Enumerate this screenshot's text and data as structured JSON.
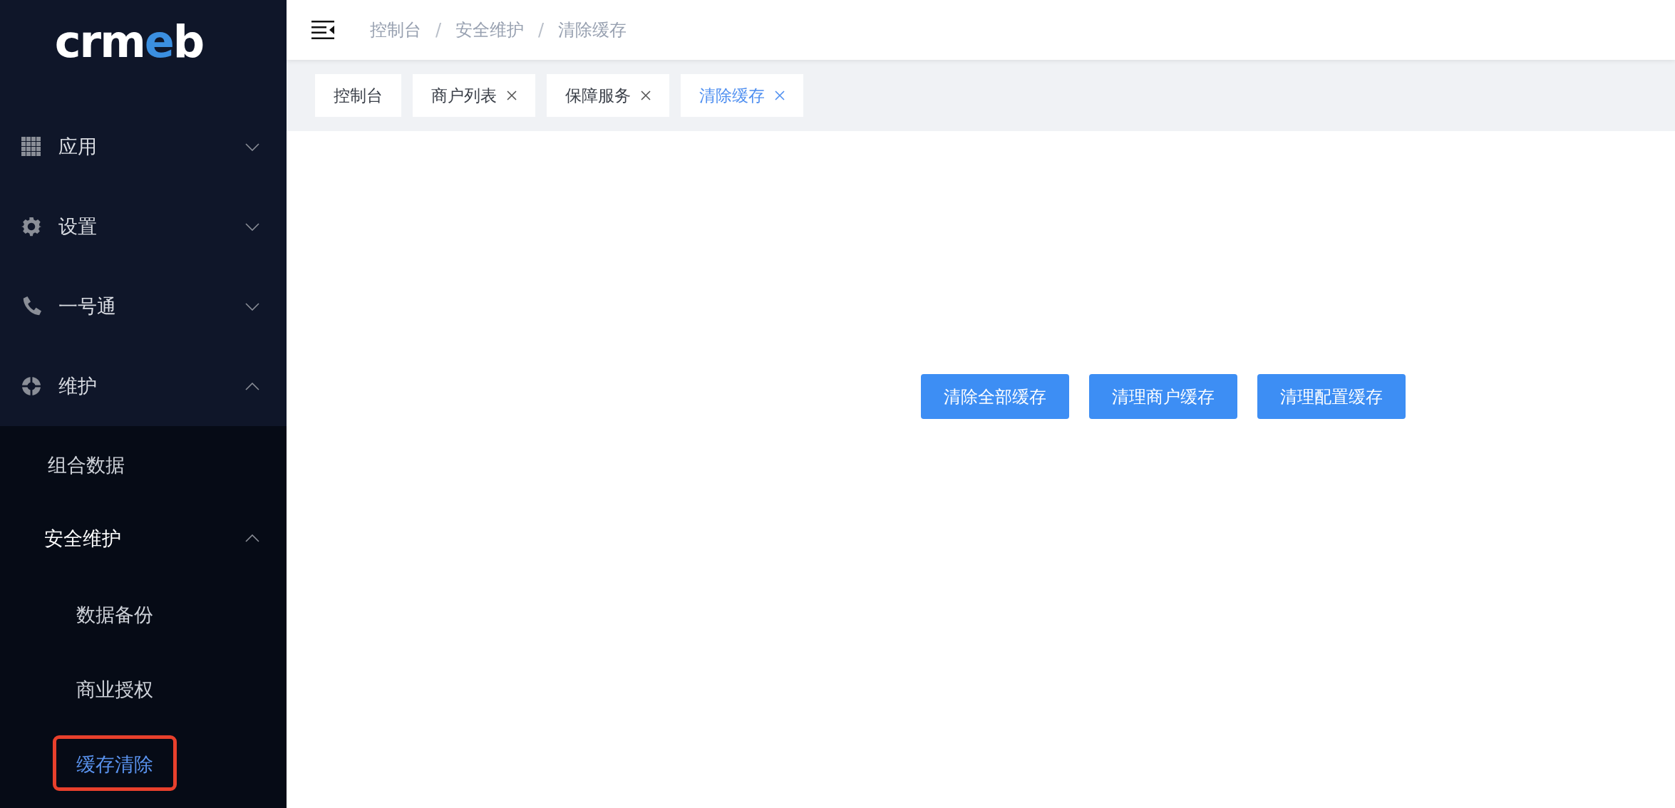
{
  "sidebar": {
    "logo": [
      {
        "text": "crm",
        "accent": false
      },
      {
        "text": "e",
        "accent": true
      },
      {
        "text": "b",
        "accent": false
      }
    ],
    "menu": [
      {
        "label": "应用",
        "kind": "grid",
        "expanded": false
      },
      {
        "label": "设置",
        "kind": "gear",
        "expanded": false
      },
      {
        "label": "一号通",
        "kind": "phone",
        "expanded": false
      },
      {
        "label": "维护",
        "kind": "ring",
        "expanded": true,
        "children": [
          {
            "label": "组合数据",
            "selected": false,
            "highlighted": false
          },
          {
            "label": "安全维护",
            "expanded": true,
            "children": [
              {
                "label": "数据备份",
                "selected": false,
                "highlighted": false
              },
              {
                "label": "商业授权",
                "selected": false,
                "highlighted": false
              },
              {
                "label": "缓存清除",
                "selected": true,
                "highlighted": true
              }
            ]
          }
        ]
      }
    ]
  },
  "header": {
    "breadcrumb": [
      "控制台",
      "安全维护",
      "清除缓存"
    ],
    "separator": "/"
  },
  "tabs": [
    {
      "label": "控制台",
      "closable": false,
      "selected": false
    },
    {
      "label": "商户列表",
      "closable": true,
      "selected": false
    },
    {
      "label": "保障服务",
      "closable": true,
      "selected": false
    },
    {
      "label": "清除缓存",
      "closable": true,
      "selected": true
    }
  ],
  "actions": [
    "清除全部缓存",
    "清理商户缓存",
    "清理配置缓存"
  ]
}
